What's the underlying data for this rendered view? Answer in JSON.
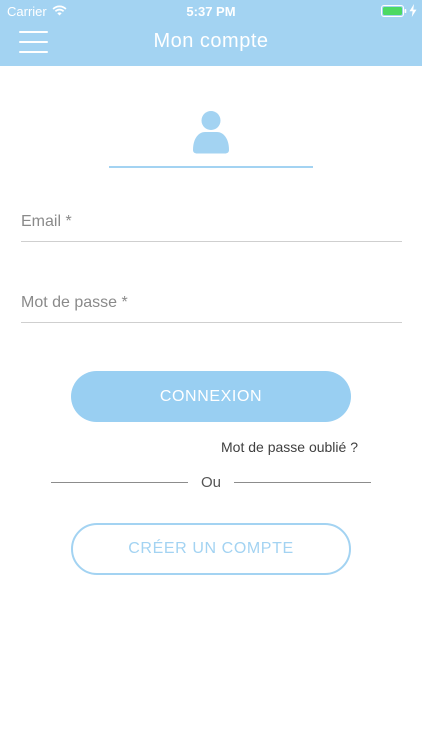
{
  "status_bar": {
    "carrier": "Carrier",
    "time": "5:37 PM",
    "wifi_icon": "wifi-icon",
    "battery_icon": "battery-icon",
    "charging_icon": "charging-bolt-icon"
  },
  "header": {
    "title": "Mon compte",
    "menu_icon": "hamburger-menu-icon"
  },
  "avatar": {
    "icon": "user-icon"
  },
  "form": {
    "email_placeholder": "Email *",
    "email_value": "",
    "password_placeholder": "Mot de passe *",
    "password_value": ""
  },
  "actions": {
    "login_label": "CONNEXION",
    "forgot_label": "Mot de passe oublié ?",
    "divider_label": "Ou",
    "create_label": "CRÉER UN COMPTE"
  },
  "colors": {
    "accent": "#a3d3f2",
    "button_fill": "#99cff2",
    "text": "#5a5a5a"
  }
}
